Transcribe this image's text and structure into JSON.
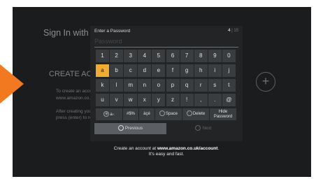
{
  "background": {
    "title": "Sign In with Your Amazon Account",
    "create_heading": "CREATE ACCOUNT",
    "line_1": "To create an account visit",
    "line_2": "www.amazon.co.uk/account",
    "line_3": "After creating your account",
    "line_4": "press (enter) to return"
  },
  "dialog": {
    "label": "Enter a Password",
    "counter_current": "4",
    "counter_sep": "|",
    "counter_max": "15",
    "placeholder": "Password"
  },
  "keyboard": {
    "row1": [
      "1",
      "2",
      "3",
      "4",
      "5",
      "6",
      "7",
      "8",
      "9",
      "0"
    ],
    "row2": [
      "a",
      "b",
      "c",
      "d",
      "e",
      "f",
      "g",
      "h",
      "i",
      "j"
    ],
    "row3": [
      "k",
      "l",
      "m",
      "n",
      "o",
      "p",
      "q",
      "r",
      "s",
      "t"
    ],
    "row4": [
      "u",
      "v",
      "w",
      "x",
      "y",
      "z",
      "!",
      ",",
      ".",
      "@"
    ],
    "row5": {
      "case_key": "a",
      "case_hint": "A",
      "symbols_key": "#$%",
      "accent_key": "àçé",
      "space_key": "Space",
      "delete_key": "Delete",
      "hide_line1": "Hide",
      "hide_line2": "Password"
    },
    "selected_key": "a"
  },
  "nav": {
    "previous_label": "Previous",
    "next_label": "Next"
  },
  "footer": {
    "prefix": "Create an account at",
    "url": "www.amazon.co.uk/account",
    "suffix": ".",
    "line2": "It's easy and fast."
  },
  "colors": {
    "accent": "#f0ac30",
    "arrow": "#f2791f"
  }
}
